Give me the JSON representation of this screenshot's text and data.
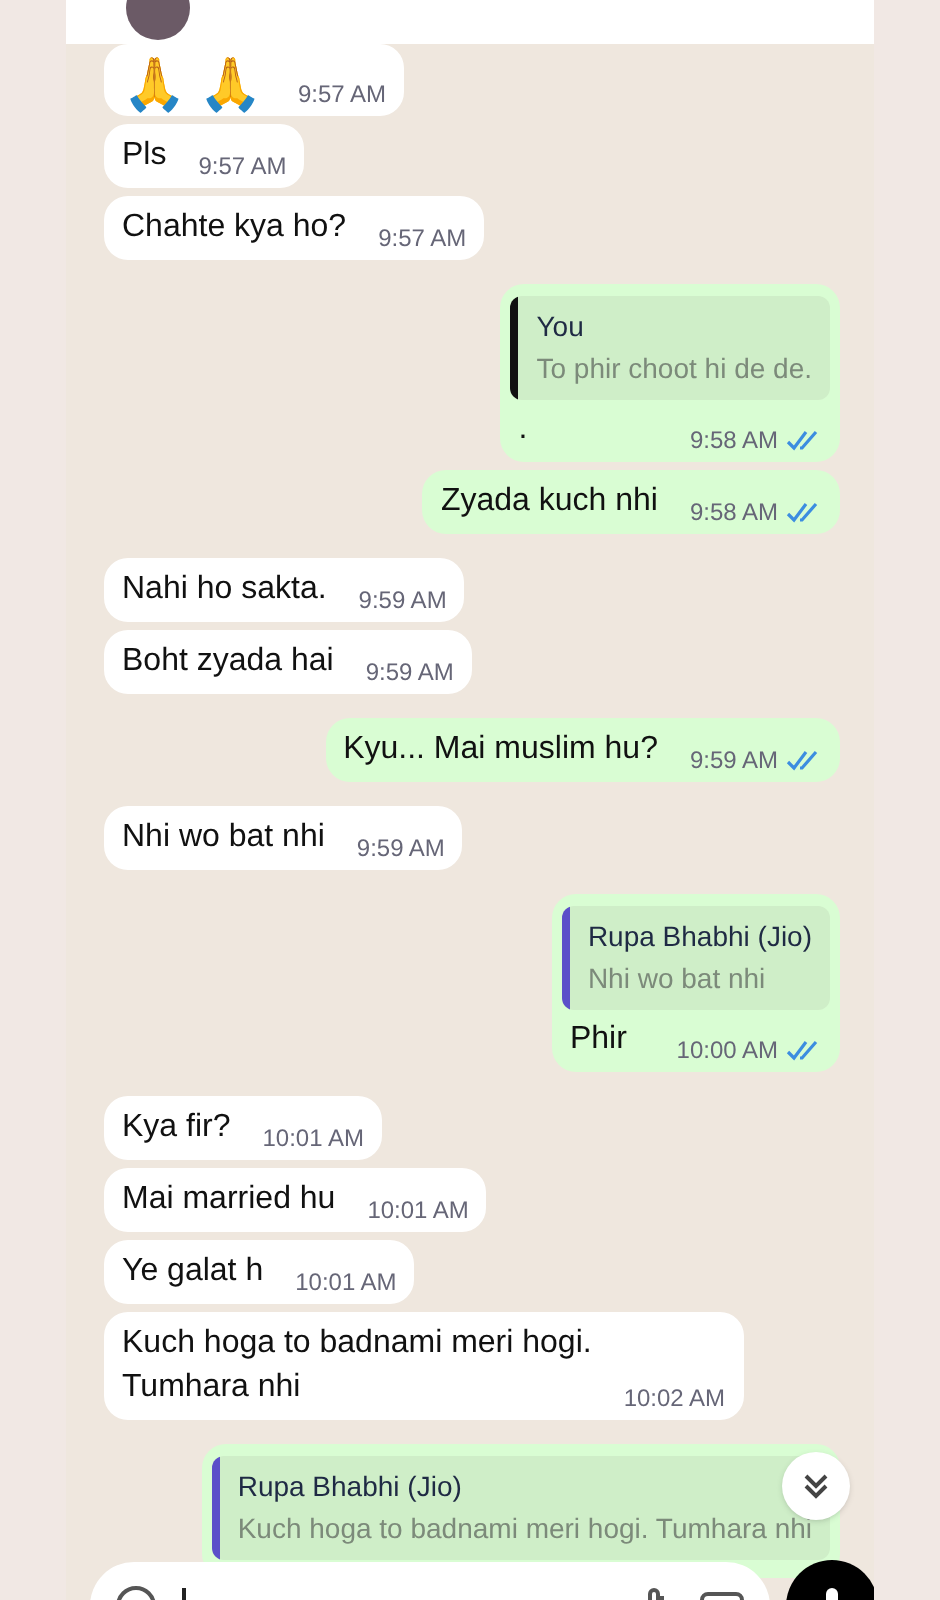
{
  "messages": [
    {
      "kind": "in",
      "text": "🙏🙏",
      "time": "9:57 AM",
      "emoji_only": true
    },
    {
      "kind": "in",
      "text": "Pls",
      "time": "9:57 AM"
    },
    {
      "kind": "in",
      "text": "Chahte kya ho?",
      "time": "9:57 AM"
    },
    {
      "kind": "out",
      "quote": {
        "author": "You",
        "text": "To phir choot hi de de.",
        "color": "#111111"
      },
      "text": ".",
      "time": "9:58 AM",
      "read": true
    },
    {
      "kind": "out",
      "text": "Zyada kuch nhi",
      "time": "9:58 AM",
      "read": true
    },
    {
      "kind": "in",
      "text": "Nahi ho sakta.",
      "time": "9:59 AM"
    },
    {
      "kind": "in",
      "text": "Boht zyada hai",
      "time": "9:59 AM"
    },
    {
      "kind": "out",
      "text": "Kyu... Mai muslim hu?",
      "time": "9:59 AM",
      "read": true
    },
    {
      "kind": "in",
      "text": "Nhi wo bat nhi",
      "time": "9:59 AM"
    },
    {
      "kind": "out",
      "quote": {
        "author": "Rupa Bhabhi (Jio)",
        "text": "Nhi wo bat nhi",
        "color": "#5b4fc9"
      },
      "text": "Phir",
      "time": "10:00 AM",
      "read": true
    },
    {
      "kind": "in",
      "text": "Kya fir?",
      "time": "10:01 AM"
    },
    {
      "kind": "in",
      "text": "Mai married hu",
      "time": "10:01 AM"
    },
    {
      "kind": "in",
      "text": "Ye galat h",
      "time": "10:01 AM"
    },
    {
      "kind": "in",
      "text": "Kuch hoga to badnami meri hogi.\nTumhara nhi",
      "time": "10:02 AM"
    },
    {
      "kind": "out",
      "quote": {
        "author": "Rupa Bhabhi (Jio)",
        "text": "Kuch hoga to badnami meri hogi. Tumhara nhi",
        "color": "#5b4fc9"
      }
    }
  ]
}
